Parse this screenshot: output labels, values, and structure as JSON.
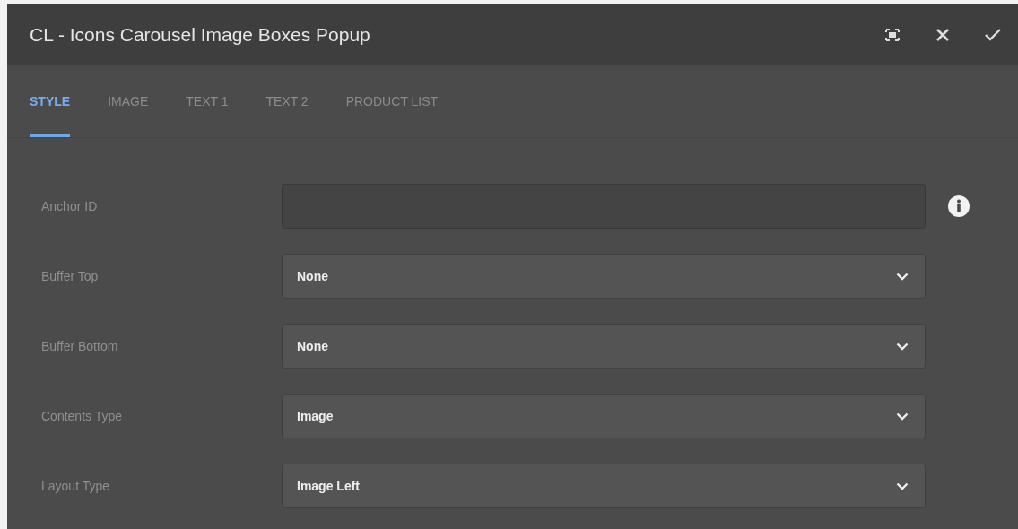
{
  "dialog": {
    "title": "CL - Icons Carousel Image Boxes Popup"
  },
  "tabs": [
    {
      "label": "STYLE",
      "selected": true
    },
    {
      "label": "IMAGE",
      "selected": false
    },
    {
      "label": "TEXT 1",
      "selected": false
    },
    {
      "label": "TEXT 2",
      "selected": false
    },
    {
      "label": "PRODUCT LIST",
      "selected": false
    }
  ],
  "fields": [
    {
      "kind": "text",
      "label": "Anchor ID",
      "info": true
    },
    {
      "kind": "select",
      "label": "Buffer Top",
      "value": "None"
    },
    {
      "kind": "select",
      "label": "Buffer Bottom",
      "value": "None"
    },
    {
      "kind": "select",
      "label": "Contents Type",
      "value": "Image"
    },
    {
      "kind": "select",
      "label": "Layout Type",
      "value": "Image Left"
    }
  ]
}
